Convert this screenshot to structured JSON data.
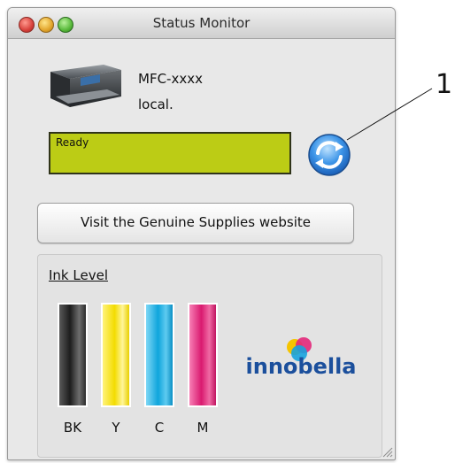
{
  "window": {
    "title": "Status Monitor"
  },
  "device": {
    "model": "MFC-xxxx",
    "host": "local."
  },
  "status": {
    "text": "Ready",
    "color": "#bccc15"
  },
  "buttons": {
    "visit_supplies": "Visit the Genuine Supplies website"
  },
  "ink": {
    "title": "Ink Level",
    "cartridges": [
      {
        "label": "BK",
        "color": "#2a2a2a",
        "level": 1.0
      },
      {
        "label": "Y",
        "color": "#f6e311",
        "level": 1.0
      },
      {
        "label": "C",
        "color": "#16b4e8",
        "level": 1.0
      },
      {
        "label": "M",
        "color": "#e2277a",
        "level": 1.0
      }
    ]
  },
  "brand": {
    "logo_text": "innobella"
  },
  "callout": {
    "number": "1"
  }
}
